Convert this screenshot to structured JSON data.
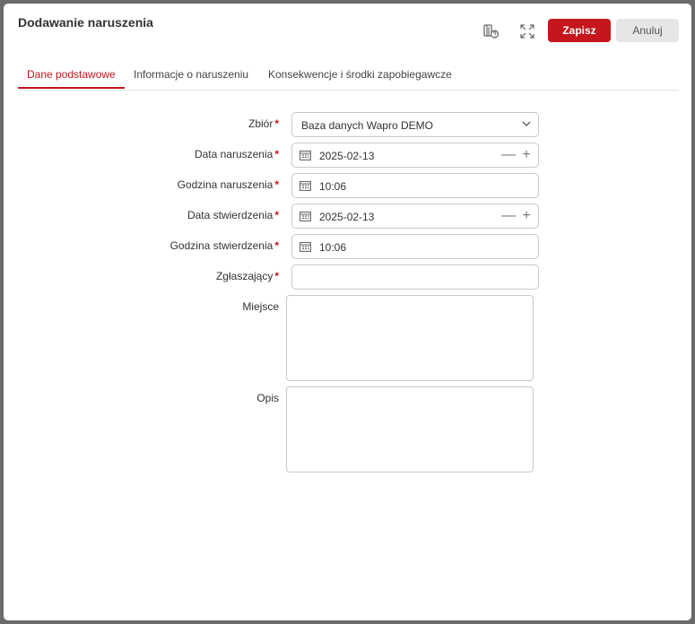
{
  "dialog": {
    "title": "Dodawanie naruszenia",
    "buttons": {
      "save": "Zapisz",
      "cancel": "Anuluj"
    }
  },
  "tabs": [
    {
      "label": "Dane podstawowe",
      "active": true
    },
    {
      "label": "Informacje o naruszeniu",
      "active": false
    },
    {
      "label": "Konsekwencje i środki zapobiegawcze",
      "active": false
    }
  ],
  "form": {
    "zbior": {
      "label": "Zbiór",
      "value": "Baza danych Wapro DEMO",
      "required": true
    },
    "data_naruszenia": {
      "label": "Data naruszenia",
      "value": "2025-02-13",
      "required": true
    },
    "godzina_naruszenia": {
      "label": "Godzina naruszenia",
      "value": "10:06",
      "required": true
    },
    "data_stwierdzenia": {
      "label": "Data stwierdzenia",
      "value": "2025-02-13",
      "required": true
    },
    "godzina_stwierdzenia": {
      "label": "Godzina stwierdzenia",
      "value": "10:06",
      "required": true
    },
    "zglaszajacy": {
      "label": "Zgłaszający",
      "value": "",
      "required": true
    },
    "miejsce": {
      "label": "Miejsce",
      "value": ""
    },
    "opis": {
      "label": "Opis",
      "value": ""
    },
    "required_mark": "*",
    "minus": "—",
    "plus": "+"
  },
  "colors": {
    "accent": "#c4161c",
    "border": "#c8c8c8"
  }
}
